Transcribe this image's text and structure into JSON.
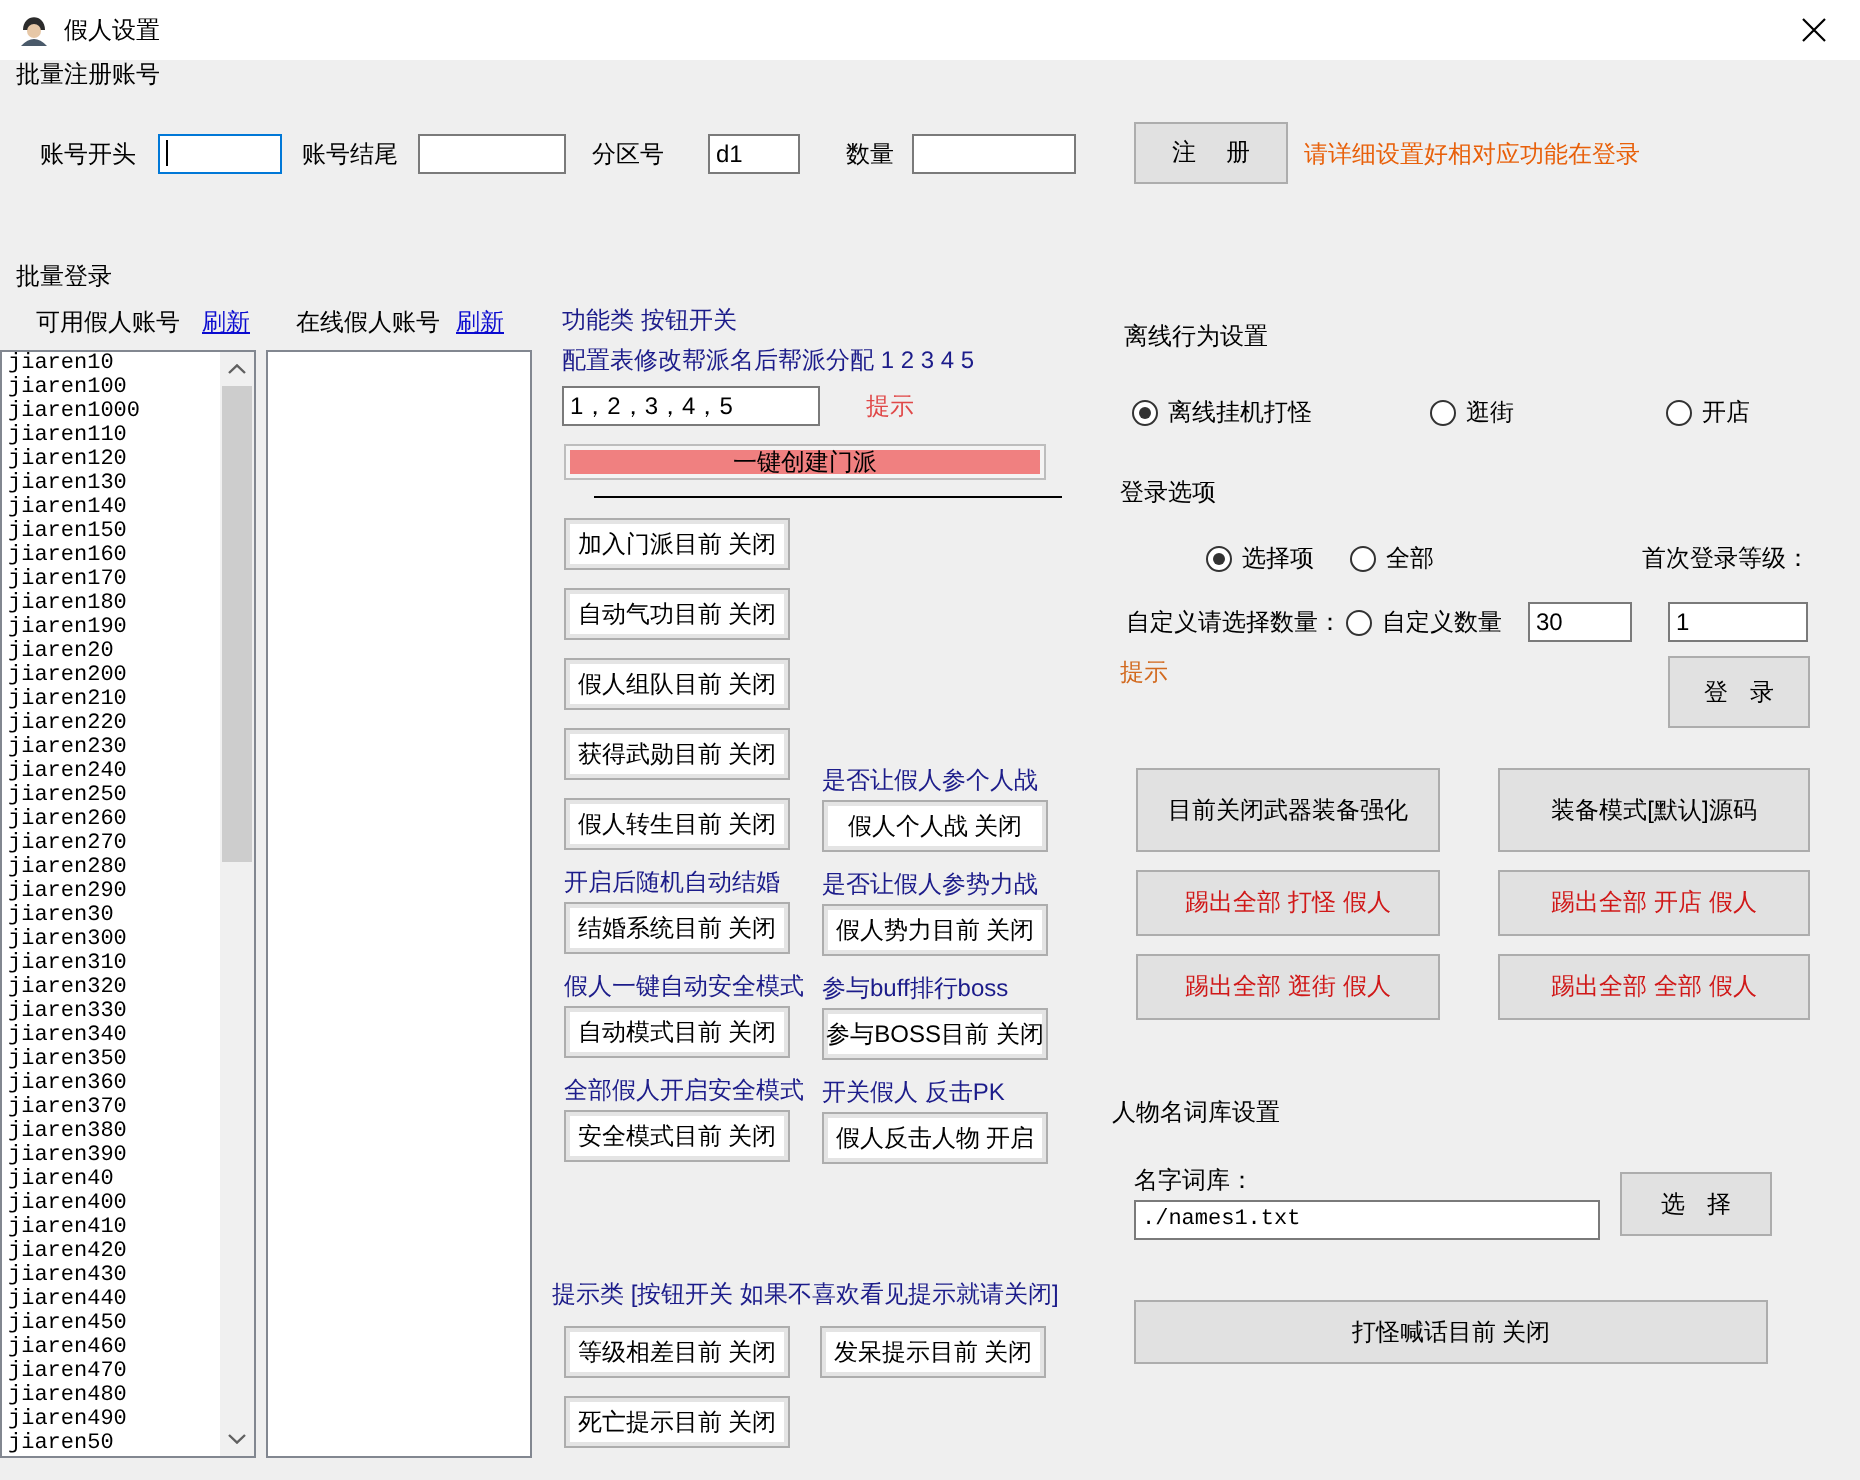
{
  "window": {
    "title": "假人设置"
  },
  "register": {
    "heading": "批量注册账号",
    "fields": [
      {
        "label": "账号开头",
        "focused": true
      },
      {
        "label": "账号结尾",
        "focused": false
      },
      {
        "label": "分区号",
        "value": "d1",
        "focused": false
      },
      {
        "label": "数量",
        "focused": false
      }
    ],
    "button": "注 册",
    "hint": "请详细设置好相对应功能在登录"
  },
  "login": {
    "heading": "批量登录",
    "available": {
      "label": "可用假人账号",
      "refresh": "刷新",
      "items": [
        "jiaren10",
        "jiaren100",
        "jiaren1000",
        "jiaren110",
        "jiaren120",
        "jiaren130",
        "jiaren140",
        "jiaren150",
        "jiaren160",
        "jiaren170",
        "jiaren180",
        "jiaren190",
        "jiaren20",
        "jiaren200",
        "jiaren210",
        "jiaren220",
        "jiaren230",
        "jiaren240",
        "jiaren250",
        "jiaren260",
        "jiaren270",
        "jiaren280",
        "jiaren290",
        "jiaren30",
        "jiaren300",
        "jiaren310",
        "jiaren320",
        "jiaren330",
        "jiaren340",
        "jiaren350",
        "jiaren360",
        "jiaren370",
        "jiaren380",
        "jiaren390",
        "jiaren40",
        "jiaren400",
        "jiaren410",
        "jiaren420",
        "jiaren430",
        "jiaren440",
        "jiaren450",
        "jiaren460",
        "jiaren470",
        "jiaren480",
        "jiaren490",
        "jiaren50"
      ]
    },
    "online": {
      "label": "在线假人账号",
      "refresh": "刷新"
    }
  },
  "functions": {
    "heading": "功能类 按钮开关",
    "config_label": "配置表修改帮派名后帮派分配 1 2 3 4 5",
    "config_value": "1，2，3，4，5",
    "hint": "提示",
    "create_button": "一键创建门派",
    "toggle_columns": [
      [
        {
          "button": "加入门派目前 关闭"
        },
        {
          "button": "自动气功目前 关闭"
        },
        {
          "button": "假人组队目前 关闭"
        },
        {
          "button": "获得武勋目前 关闭"
        },
        {
          "button": "假人转生目前 关闭"
        },
        {
          "caption": "开启后随机自动结婚",
          "button": "结婚系统目前 关闭"
        },
        {
          "caption": "假人一键自动安全模式",
          "button": "自动模式目前 关闭"
        },
        {
          "caption": "全部假人开启安全模式",
          "button": "安全模式目前 关闭"
        }
      ],
      [
        {
          "caption": "是否让假人参个人战",
          "button": "假人个人战 关闭"
        },
        {
          "caption": "是否让假人参势力战",
          "button": "假人势力目前 关闭"
        },
        {
          "caption": "参与buff排行boss",
          "button": "参与BOSS目前 关闭"
        },
        {
          "caption": "开关假人 反击PK",
          "button": "假人反击人物 开启"
        }
      ]
    ],
    "tips": {
      "heading": "提示类 [按钮开关 如果不喜欢看见提示就请关闭]",
      "buttons": [
        "等级相差目前 关闭",
        "发呆提示目前 关闭",
        "死亡提示目前 关闭"
      ]
    }
  },
  "offline": {
    "heading": "离线行为设置",
    "options": [
      {
        "label": "离线挂机打怪",
        "selected": true
      },
      {
        "label": "逛街",
        "selected": false
      },
      {
        "label": "开店",
        "selected": false
      }
    ]
  },
  "login_options": {
    "heading": "登录选项",
    "options": [
      {
        "label": "选择项",
        "selected": true
      },
      {
        "label": "全部",
        "selected": false
      },
      {
        "label": "自定义数量",
        "selected": false
      }
    ],
    "custom_label": "自定义请选择数量：",
    "custom_count": "30",
    "first_level_label": "首次登录等级：",
    "first_level": "1",
    "hint": "提示",
    "login_button": "登 录"
  },
  "actions": [
    {
      "label": "目前关闭武器装备强化",
      "kind": "normal"
    },
    {
      "label": "装备模式[默认]源码",
      "kind": "normal"
    },
    {
      "label": "踢出全部 打怪 假人",
      "kind": "kick"
    },
    {
      "label": "踢出全部 开店 假人",
      "kind": "kick"
    },
    {
      "label": "踢出全部 逛街 假人",
      "kind": "kick"
    },
    {
      "label": "踢出全部 全部 假人",
      "kind": "kick"
    }
  ],
  "names": {
    "heading": "人物名词库设置",
    "field_label": "名字词库：",
    "path": "./names1.txt",
    "choose_button": "选 择",
    "shout_button": "打怪喊话目前 关闭"
  }
}
